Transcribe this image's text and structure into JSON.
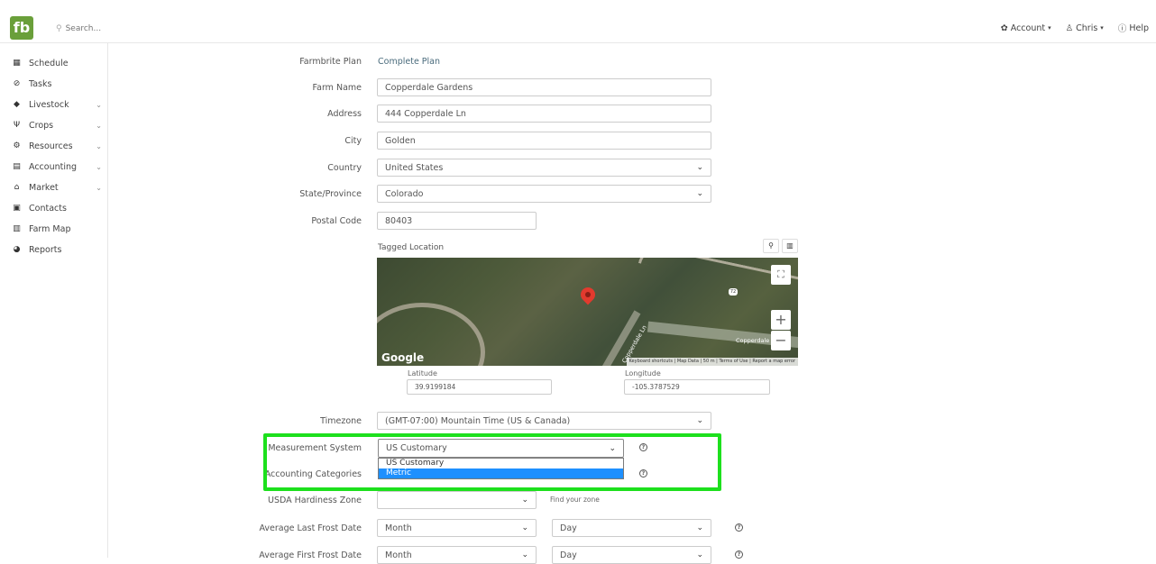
{
  "header": {
    "logo": "fb",
    "search_placeholder": "Search...",
    "account_label": "Account",
    "user_label": "Chris",
    "help_label": "Help"
  },
  "sidebar": {
    "items": [
      {
        "label": "Schedule",
        "icon": "calendar-icon",
        "expandable": false
      },
      {
        "label": "Tasks",
        "icon": "check-circle-icon",
        "expandable": false
      },
      {
        "label": "Livestock",
        "icon": "livestock-icon",
        "expandable": true
      },
      {
        "label": "Crops",
        "icon": "sprout-icon",
        "expandable": true
      },
      {
        "label": "Resources",
        "icon": "resources-icon",
        "expandable": true
      },
      {
        "label": "Accounting",
        "icon": "calculator-icon",
        "expandable": true
      },
      {
        "label": "Market",
        "icon": "store-icon",
        "expandable": true
      },
      {
        "label": "Contacts",
        "icon": "contacts-icon",
        "expandable": false
      },
      {
        "label": "Farm Map",
        "icon": "map-icon",
        "expandable": false
      },
      {
        "label": "Reports",
        "icon": "pie-chart-icon",
        "expandable": false
      }
    ]
  },
  "form": {
    "plan_label": "Farmbrite Plan",
    "plan_value": "Complete Plan",
    "farm_name_label": "Farm Name",
    "farm_name_value": "Copperdale Gardens",
    "address_label": "Address",
    "address_value": "444 Copperdale Ln",
    "city_label": "City",
    "city_value": "Golden",
    "country_label": "Country",
    "country_value": "United States",
    "state_label": "State/Province",
    "state_value": "Colorado",
    "postal_label": "Postal Code",
    "postal_value": "80403",
    "tagged_location_label": "Tagged Location",
    "latitude_label": "Latitude",
    "latitude_value": "39.9199184",
    "longitude_label": "Longitude",
    "longitude_value": "-105.3787529",
    "timezone_label": "Timezone",
    "timezone_value": "(GMT-07:00) Mountain Time (US & Canada)",
    "measurement_label": "Measurement System",
    "measurement_value": "US Customary",
    "measurement_options": [
      "US Customary",
      "Metric"
    ],
    "measurement_highlighted": "Metric",
    "accounting_categories_label": "Accounting Categories",
    "usda_label": "USDA Hardiness Zone",
    "usda_value": "",
    "find_zone_link": "Find your zone",
    "last_frost_label": "Average Last Frost Date",
    "first_frost_label": "Average First Frost Date",
    "month_placeholder": "Month",
    "day_placeholder": "Day"
  },
  "map": {
    "google_label": "Google",
    "attribution": "Keyboard shortcuts | Map Data | 50 m | Terms of Use | Report a map error",
    "place_label": "Copperdale",
    "road_label": "Copperdale Ln",
    "road_number": "72"
  },
  "colors": {
    "brand": "#6a9f3a",
    "highlight": "#1de01d",
    "selected_option": "#1e90ff"
  }
}
